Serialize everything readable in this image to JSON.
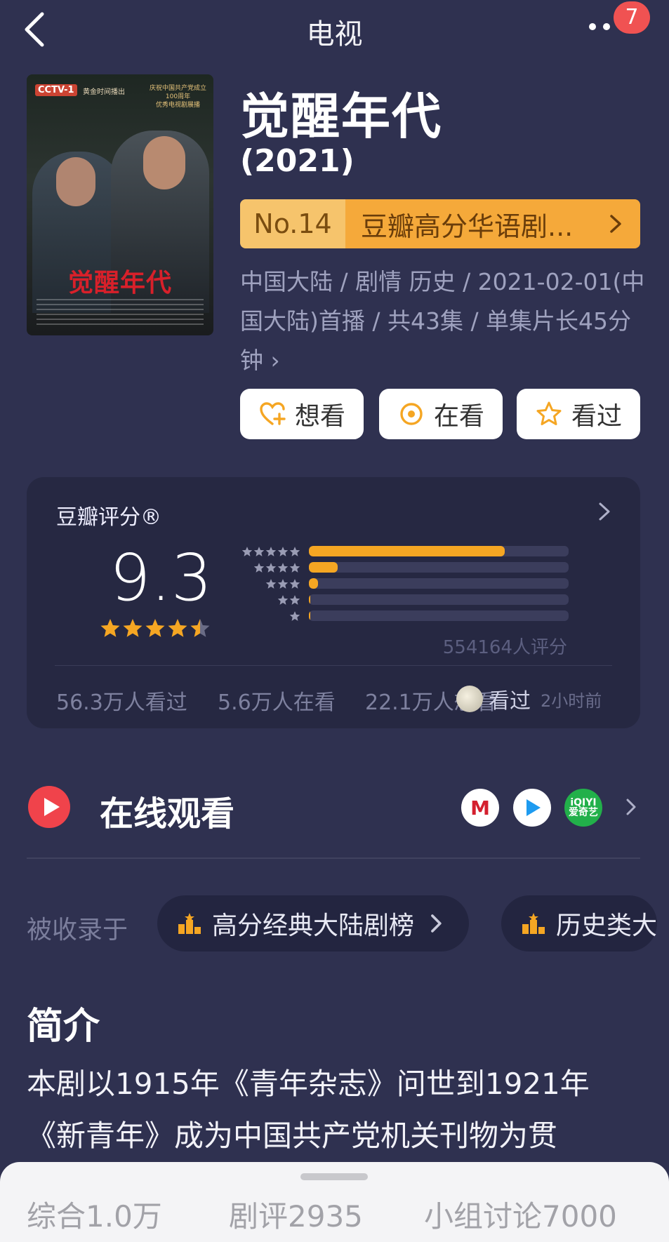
{
  "header": {
    "title": "电视",
    "badge_count": "7"
  },
  "poster": {
    "channel": "CCTV-1",
    "tag": "黄金时间播出",
    "corner": "庆祝中国共产党成立\n100周年\n优秀电视剧展播",
    "title": "觉醒年代"
  },
  "show": {
    "title": "觉醒年代",
    "year": "(2021)",
    "rank_no": "No.14",
    "rank_list": "豆瓣高分华语剧...",
    "meta": "中国大陆 / 剧情 历史 / 2021-02-01(中国大陆)首播 / 共43集 / 单集片长45分钟",
    "meta_arrow": "›"
  },
  "actions": {
    "want": "想看",
    "watching": "在看",
    "watched": "看过"
  },
  "rating": {
    "label": "豆瓣评分®",
    "score": "9.3",
    "star_value": 4.5,
    "distribution": [
      {
        "stars": 5,
        "percent": 75.5
      },
      {
        "stars": 4,
        "percent": 11
      },
      {
        "stars": 3,
        "percent": 3.5
      },
      {
        "stars": 2,
        "percent": 0.6
      },
      {
        "stars": 1,
        "percent": 0.6
      }
    ],
    "votes": "554164人评分",
    "watched": "56.3万人看过",
    "watching": "5.6万人在看",
    "want": "22.1万人想看",
    "friend_action": "看过",
    "friend_time": "2小时前"
  },
  "online": {
    "title": "在线观看",
    "platforms": [
      "M",
      "▶",
      "iQIYI 爱奇艺"
    ]
  },
  "included": {
    "label": "被收录于",
    "lists": [
      "高分经典大陆剧榜",
      "历史类大"
    ]
  },
  "intro": {
    "heading": "简介",
    "text": "本剧以1915年《青年杂志》问世到1921年《新青年》成为中国共产党机关刊物为贯"
  },
  "tabs": [
    "综合1.0万",
    "剧评2935",
    "小组讨论7000"
  ],
  "colors": {
    "accent": "#f5a623",
    "background": "#2f3150",
    "card": "#262842",
    "play": "#f0434b"
  }
}
